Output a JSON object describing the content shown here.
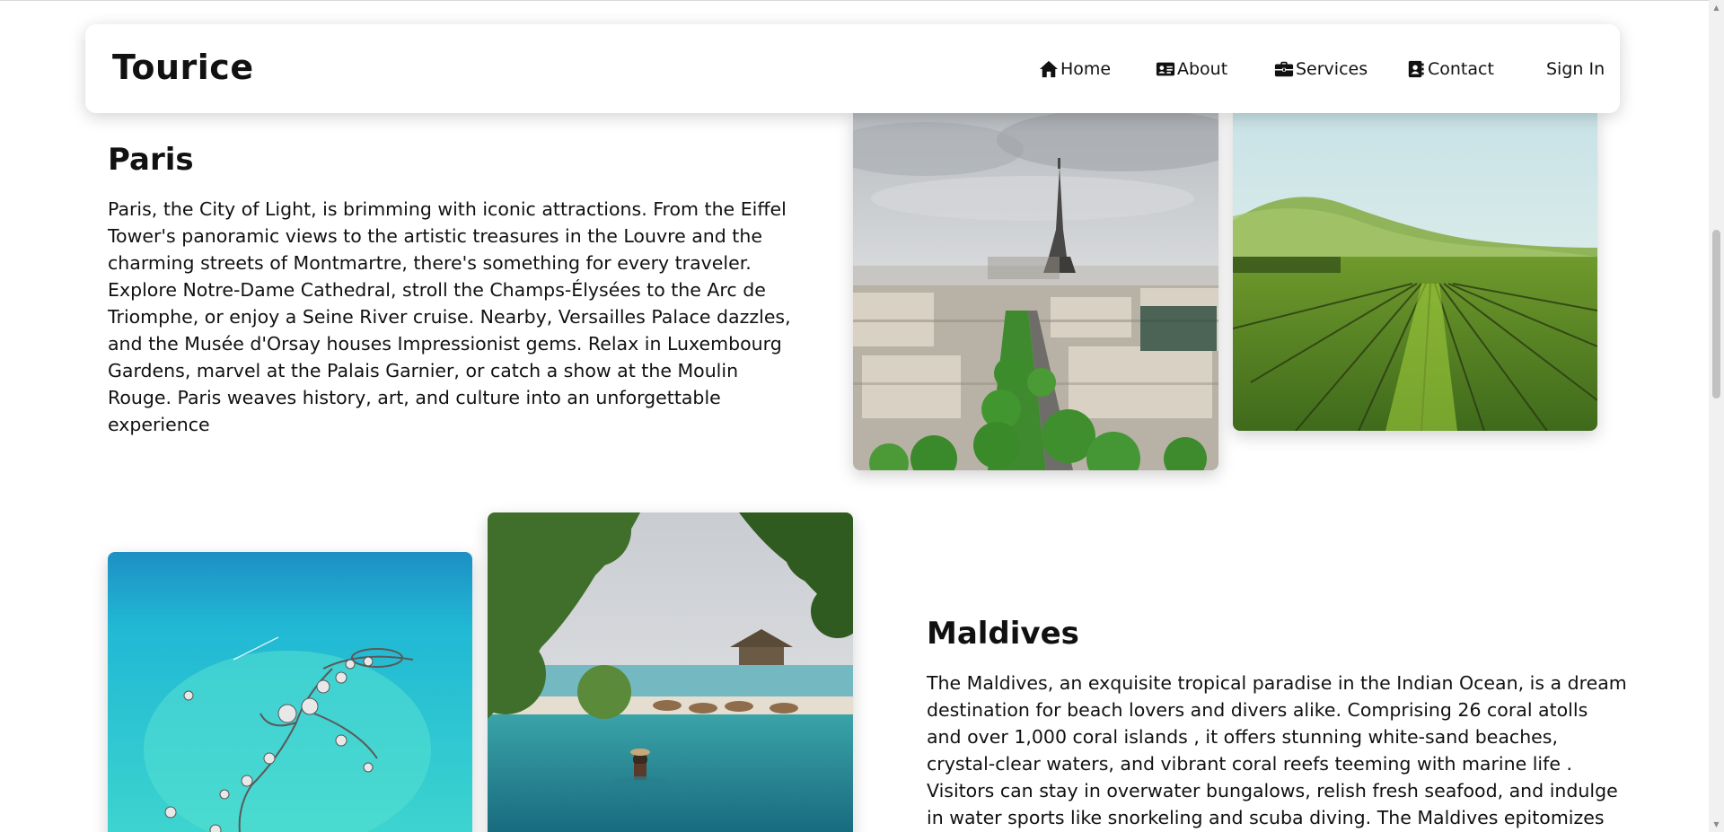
{
  "brand": "Tourice",
  "nav": {
    "home": "Home",
    "about": "About",
    "services": "Services",
    "contact": "Contact",
    "signin": "Sign In"
  },
  "sections": {
    "paris": {
      "title": "Paris",
      "text": "Paris, the City of Light, is brimming with iconic attractions. From the Eiffel Tower's panoramic views to the artistic treasures in the Louvre and the charming streets of Montmartre, there's something for every traveler. Explore Notre-Dame Cathedral, stroll the Champs-Élysées to the Arc de Triomphe, or enjoy a Seine River cruise. Nearby, Versailles Palace dazzles, and the Musée d'Orsay houses Impressionist gems. Relax in Luxembourg Gardens, marvel at the Palais Garnier, or catch a show at the Moulin Rouge. Paris weaves history, art, and culture into an unforgettable experience"
    },
    "maldives": {
      "title": "Maldives",
      "text": "The Maldives, an exquisite tropical paradise in the Indian Ocean, is a dream destination for beach lovers and divers alike. Comprising 26 coral atolls and over 1,000 coral islands , it offers stunning white-sand beaches, crystal-clear waters, and vibrant coral reefs teeming with marine life . Visitors can stay in overwater bungalows, relish fresh seafood, and indulge in water sports like snorkeling and scuba diving. The Maldives epitomizes luxury and natural"
    }
  },
  "icons": {
    "home": "home-icon",
    "about": "id-card-icon",
    "services": "briefcase-icon",
    "contact": "address-book-icon"
  }
}
